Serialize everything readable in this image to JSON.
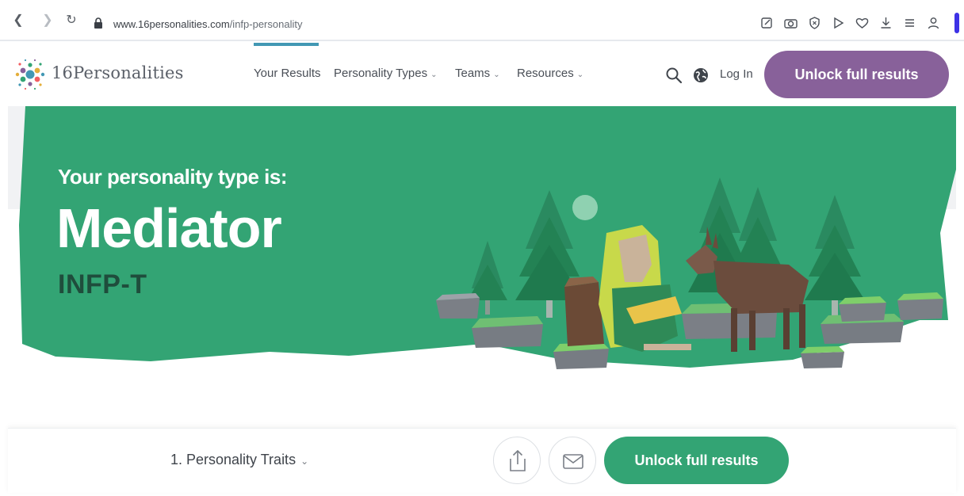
{
  "browser": {
    "url_host": "www.16personalities.com",
    "url_path": "/infp-personality",
    "icons": [
      "back-icon",
      "forward-icon",
      "reload-icon",
      "lock-icon",
      "edit-icon",
      "camera-icon",
      "shield-icon",
      "play-icon",
      "heart-icon",
      "download-icon",
      "list-icon",
      "profile-icon"
    ]
  },
  "header": {
    "logo_text": "16Personalities",
    "nav": [
      {
        "label": "Your Results",
        "active": true
      },
      {
        "label": "Personality Types",
        "dropdown": true
      },
      {
        "label": "Teams",
        "dropdown": true
      },
      {
        "label": "Resources",
        "dropdown": true
      }
    ],
    "login_label": "Log In",
    "cta_label": "Unlock full results"
  },
  "hero": {
    "title": "Your personality type is:",
    "type_name": "Mediator",
    "type_code": "INFP-T"
  },
  "bottom": {
    "section_label": "1. Personality Traits",
    "cta_label": "Unlock full results"
  },
  "colors": {
    "accent_purple": "#88619a",
    "accent_green": "#33a474",
    "nav_active": "#4298b4"
  }
}
